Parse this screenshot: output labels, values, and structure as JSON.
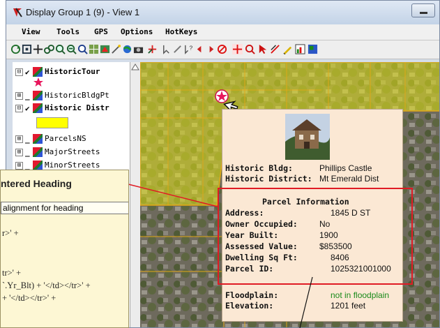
{
  "window": {
    "title": "Display Group 1 (9) - View 1"
  },
  "menu": [
    "View",
    "Tools",
    "GPS",
    "Options",
    "HotKeys"
  ],
  "legend": {
    "layers": [
      {
        "expander": "⊟",
        "checked": true,
        "name": "HistoricTour",
        "bold": true
      },
      {
        "expander": "⊞",
        "checked": false,
        "name": "HistoricBldgPt",
        "bold": false
      },
      {
        "expander": "⊟",
        "checked": true,
        "name": "Historic Distr",
        "bold": true
      },
      {
        "expander": "⊞",
        "checked": false,
        "name": "ParcelsNS",
        "bold": false
      },
      {
        "expander": "⊞",
        "checked": false,
        "name": "MajorStreets",
        "bold": false
      },
      {
        "expander": "⊞",
        "checked": false,
        "name": "MinorStreets",
        "bold": false
      }
    ],
    "district_swatch_color": "#ffff00"
  },
  "popup": {
    "historic_bldg_label": "Historic Bldg:",
    "historic_bldg_value": "Phillips Castle",
    "historic_district_label": "Historic District:",
    "historic_district_value": "Mt Emerald Dist",
    "parcel_heading": "Parcel Information",
    "parcel_rows": [
      {
        "label": "Address:",
        "value": "1845 D ST"
      },
      {
        "label": "Owner Occupied:",
        "value": "No"
      },
      {
        "label": "Year Built:",
        "value": "1900"
      },
      {
        "label": "Assessed Value:",
        "value": "$853500"
      },
      {
        "label": "Dwelling Sq Ft:",
        "value": "8406"
      },
      {
        "label": "Parcel ID:",
        "value": "1025321001000"
      }
    ],
    "floodplain_label": "Floodplain:",
    "floodplain_value": "not in floodplain",
    "elevation_label": "Elevation:",
    "elevation_value": "1201 feet"
  },
  "callout": {
    "heading": "ntered Heading",
    "subtext": "alignment for heading",
    "code_lines": [
      "r>' +",
      "tr>' +",
      "`.Yr_Blt) + '</td></tr>' +",
      "+ '</td></tr>' +"
    ]
  },
  "colors": {
    "parcel_box": "#e01b24",
    "floodplain_value": "#1a8a1a",
    "district_overlay": "#e6e31c"
  }
}
